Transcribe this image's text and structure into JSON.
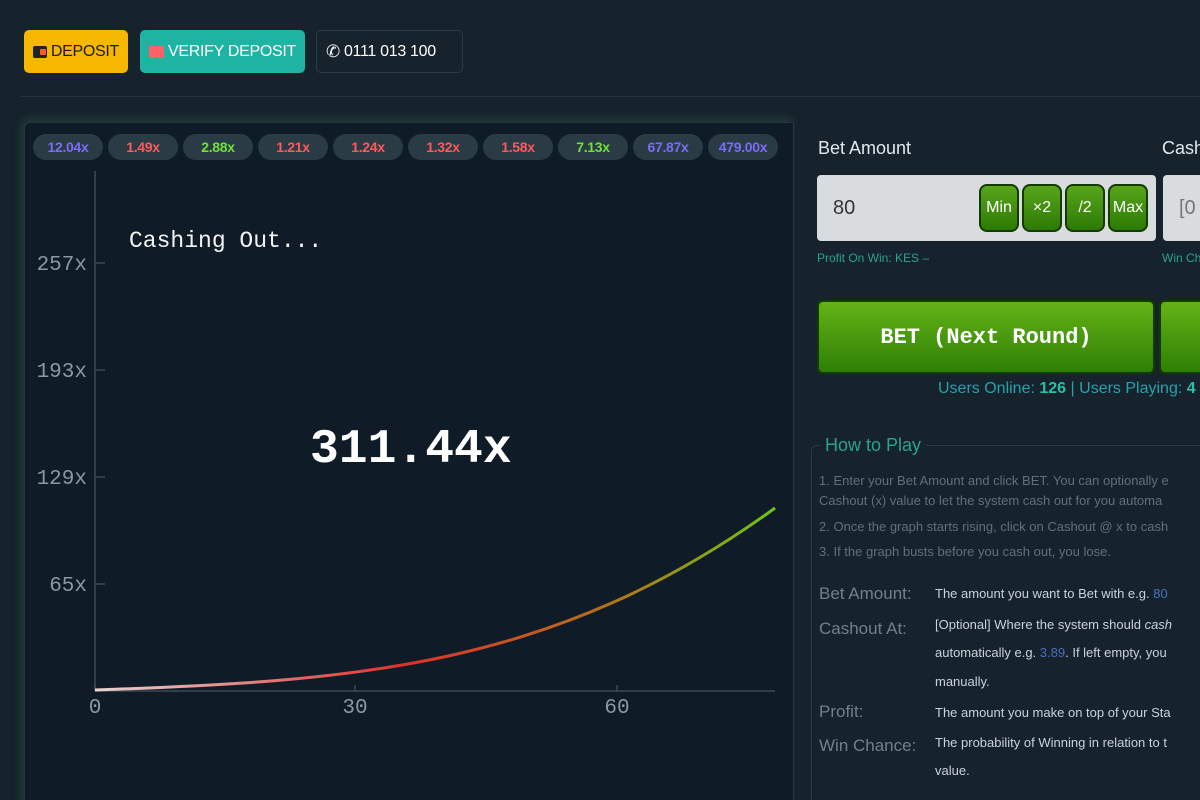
{
  "toolbar": {
    "deposit_label": "DEPOSIT",
    "verify_label": "VERIFY DEPOSIT",
    "phone_label": "0111 013 100"
  },
  "history": [
    {
      "label": "12.04x",
      "color": "#7b6cf6"
    },
    {
      "label": "1.49x",
      "color": "#ff5959"
    },
    {
      "label": "2.88x",
      "color": "#6fe13a"
    },
    {
      "label": "1.21x",
      "color": "#ff5959"
    },
    {
      "label": "1.24x",
      "color": "#ff5959"
    },
    {
      "label": "1.32x",
      "color": "#ff5959"
    },
    {
      "label": "1.58x",
      "color": "#ff5959"
    },
    {
      "label": "7.13x",
      "color": "#6fe13a"
    },
    {
      "label": "67.87x",
      "color": "#7b6cf6"
    },
    {
      "label": "479.00x",
      "color": "#7b6cf6"
    }
  ],
  "game": {
    "status": "Cashing Out...",
    "multiplier": "311.44x",
    "y_ticks": [
      "257x",
      "193x",
      "129x",
      "65x"
    ],
    "x_ticks": [
      "0",
      "30",
      "60"
    ]
  },
  "bet": {
    "label": "Bet Amount",
    "value": "80",
    "min_label": "Min",
    "double_label": "×2",
    "half_label": "/2",
    "max_label": "Max",
    "profit_note": "Profit On Win: KES –",
    "bet_button": "BET (Next Round)"
  },
  "cashout": {
    "label": "Cash",
    "placeholder": "[0",
    "note": "Win Ch"
  },
  "stats": {
    "online_label": "Users Online:",
    "online_value": "126",
    "separator": "|",
    "playing_label": "Users Playing:",
    "playing_value": "4"
  },
  "howto": {
    "title": "How to Play",
    "steps": [
      "1. Enter your Bet Amount and click BET. You can optionally e",
      "Cashout (x) value to let the system cash out for you automa",
      "2. Once the graph starts rising, click on Cashout @ x to cash",
      "3. If the graph busts before you cash out, you lose."
    ],
    "bet_term": "Bet Amount:",
    "bet_def_a": "The amount you want to Bet with e.g.",
    "bet_def_b": "80",
    "cash_term": "Cashout At:",
    "cash_def_1a": "[Optional] Where the system should",
    "cash_def_1b": "cash",
    "cash_def_2a": "automatically e.g.",
    "cash_def_2b": "3.89",
    "cash_def_2c": ". If left empty, you",
    "cash_def_3": "manually.",
    "profit_term": "Profit:",
    "profit_def": "The amount you make on top of your Sta",
    "chance_term": "Win Chance:",
    "chance_def_1": "The probability of Winning in relation to t",
    "chance_def_2": "value."
  }
}
